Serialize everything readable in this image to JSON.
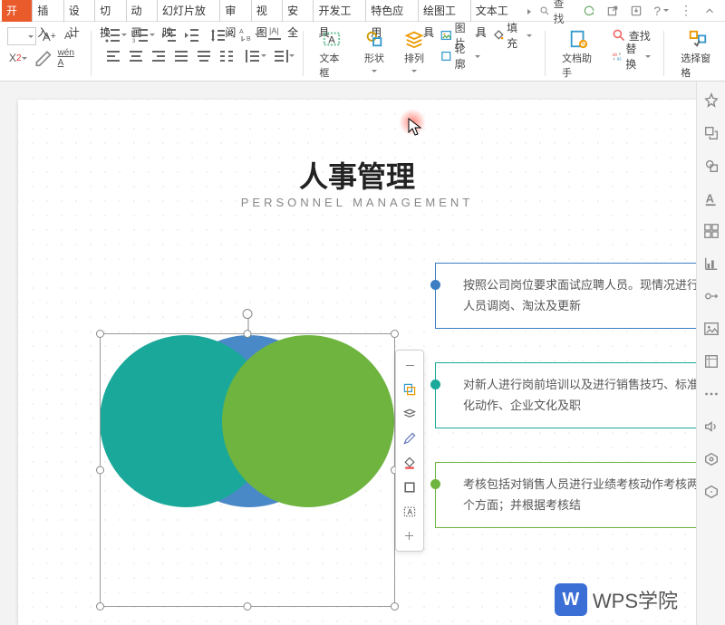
{
  "menubar": {
    "tabs": [
      "开始",
      "插入",
      "设计",
      "切换",
      "动画",
      "幻灯片放映",
      "审阅",
      "视图",
      "安全",
      "开发工具",
      "特色应用",
      "绘图工具",
      "文本工具"
    ],
    "search": "查找",
    "active_index": 0
  },
  "toolbar": {
    "textbox": "文本框",
    "shape": "形状",
    "arrange": "排列",
    "picture": "图片",
    "fill": "填充",
    "outline": "轮廓",
    "dochelp": "文档助手",
    "find": "查找",
    "replace": "替换",
    "selectpane": "选择窗格"
  },
  "slide": {
    "title_cn": "人事管理",
    "title_en": "PERSONNEL MANAGEMENT",
    "cards": [
      "按照公司岗位要求面试应聘人员。现情况进行人员调岗、淘汰及更新",
      "对新人进行岗前培训以及进行销售技巧、标准化动作、企业文化及职",
      "考核包括对销售人员进行业绩考核动作考核两个方面；并根据考核结"
    ]
  },
  "venn_colors": {
    "blue": "#4a89c7",
    "teal": "#1aa89a",
    "green": "#6eb43f"
  },
  "watermark": "WPS学院"
}
